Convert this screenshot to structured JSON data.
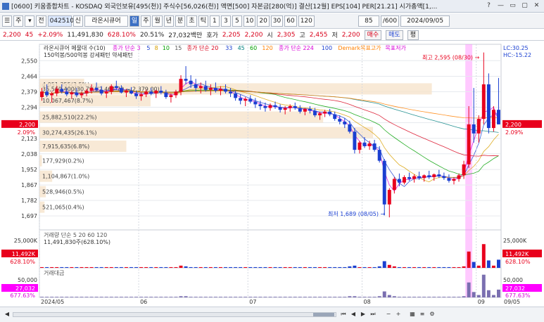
{
  "window": {
    "title": "[0600] 키움종합차트 - KOSDAQ 외국인보유[495(천)] 주식수[56,026(천)] 액면[500] 자본금[280(억)] 결산[12월] EPS[104] PER[21.21] 시가총액[1,...",
    "buttons": [
      "?",
      "—",
      "▭",
      "▢",
      "✕"
    ]
  },
  "toolbar": {
    "items": [
      "☰",
      "주",
      "▾",
      "전",
      "042510",
      "신",
      "라온시큐어",
      "일",
      "주",
      "월",
      "년",
      "분",
      "초",
      "틱",
      "1",
      "3",
      "5",
      "10",
      "20",
      "30",
      "60",
      "120"
    ],
    "count_value": "85",
    "count_total": "/600",
    "date": "2024/09/05"
  },
  "info": {
    "price": "2,200",
    "change": "45",
    "change_pct": "+2.09%",
    "volume": "11,491,830",
    "volume_pct": "628.10%",
    "turnover": "20.51%",
    "amount": "27,032백만",
    "ask_label": "호가",
    "ask": "2,205",
    "bid": "2,200",
    "open_label": "시",
    "open": "2,305",
    "high_label": "고",
    "high": "2,455",
    "low_label": "저",
    "low": "2,200",
    "buy": "매수",
    "sell": "매도",
    "avg": "평"
  },
  "chart_data": {
    "type": "candlestick",
    "price_axis": [
      "2,550",
      "2,464",
      "2,379",
      "2,294",
      "2,209",
      "2,123",
      "2,038",
      "1,952",
      "1,867",
      "1,782",
      "1,697"
    ],
    "ylim": [
      1620,
      2640
    ],
    "legend_line1": [
      {
        "text": "라온시큐어 메물대 수(10)",
        "color": "#333333"
      },
      {
        "text": "종가 단순 3",
        "color": "#d800d8"
      },
      {
        "text": "5",
        "color": "#1a3fd1"
      },
      {
        "text": "8",
        "color": "#d8a000"
      },
      {
        "text": "10",
        "color": "#00a000"
      },
      {
        "text": "15",
        "color": "#555555"
      },
      {
        "text": "종가 단순 20",
        "color": "#d8001a"
      },
      {
        "text": "33",
        "color": "#1a3fd1"
      },
      {
        "text": "45",
        "color": "#008080"
      },
      {
        "text": "60",
        "color": "#00a000"
      },
      {
        "text": "120",
        "color": "#ff8000"
      },
      {
        "text": "종가 단순 224",
        "color": "#d800d8"
      },
      {
        "text": "100",
        "color": "#1a3fd1"
      },
      {
        "text": "Demark목표고가",
        "color": "#ff8000"
      },
      {
        "text": "목표저가",
        "color": "#d800d8"
      }
    ],
    "legend_line2": "150억봉/500억봉 강세패턴 약세패턴",
    "lc_label": "LC:30.25",
    "hc_label": "HC:-15.22",
    "current_price_label": "2,200",
    "current_pct_label": "2.09%",
    "annotations": {
      "high": "최고 2,595 (08/30)",
      "low": "최저 1,689 (08/05)"
    },
    "volume_profile": [
      {
        "price": 2420,
        "label": "4,051,355(3.5%)"
      },
      {
        "price": 2330,
        "label": "10,067,467(8.7%)"
      },
      {
        "price": 2395,
        "label": "35,560,400(30.7%)(2,464.70 ~ 2,379.00)"
      },
      {
        "price": 2240,
        "label": "25,882,510(22.2%)"
      },
      {
        "price": 2155,
        "label": "30,274,435(26.1%)"
      },
      {
        "price": 2080,
        "label": "7,915,635(6.8%)"
      },
      {
        "price": 2000,
        "label": "177,929(0.2%)"
      },
      {
        "price": 1915,
        "label": "1,104,867(1.0%)"
      },
      {
        "price": 1830,
        "label": "528,946(0.5%)"
      },
      {
        "price": 1745,
        "label": "521,065(0.4%)"
      }
    ],
    "dates": [
      "2024/05",
      "06",
      "07",
      "08",
      "09",
      "09/05"
    ],
    "candles": [
      [
        2350,
        2400,
        2330,
        2380
      ],
      [
        2380,
        2420,
        2350,
        2360
      ],
      [
        2360,
        2380,
        2320,
        2370
      ],
      [
        2370,
        2410,
        2355,
        2395
      ],
      [
        2395,
        2420,
        2370,
        2380
      ],
      [
        2380,
        2400,
        2355,
        2365
      ],
      [
        2365,
        2385,
        2340,
        2375
      ],
      [
        2375,
        2400,
        2350,
        2360
      ],
      [
        2360,
        2380,
        2345,
        2370
      ],
      [
        2370,
        2395,
        2355,
        2385
      ],
      [
        2385,
        2420,
        2370,
        2400
      ],
      [
        2400,
        2430,
        2380,
        2390
      ],
      [
        2390,
        2410,
        2360,
        2370
      ],
      [
        2370,
        2390,
        2345,
        2380
      ],
      [
        2380,
        2420,
        2365,
        2410
      ],
      [
        2410,
        2440,
        2390,
        2400
      ],
      [
        2400,
        2415,
        2370,
        2375
      ],
      [
        2375,
        2395,
        2350,
        2385
      ],
      [
        2385,
        2405,
        2365,
        2370
      ],
      [
        2370,
        2385,
        2340,
        2355
      ],
      [
        2355,
        2375,
        2330,
        2365
      ],
      [
        2365,
        2390,
        2350,
        2380
      ],
      [
        2380,
        2400,
        2360,
        2370
      ],
      [
        2370,
        2390,
        2345,
        2385
      ],
      [
        2385,
        2410,
        2365,
        2375
      ],
      [
        2375,
        2390,
        2340,
        2350
      ],
      [
        2350,
        2370,
        2320,
        2360
      ],
      [
        2360,
        2390,
        2345,
        2380
      ],
      [
        2380,
        2470,
        2360,
        2450
      ],
      [
        2450,
        2520,
        2420,
        2440
      ],
      [
        2440,
        2470,
        2400,
        2420
      ],
      [
        2420,
        2450,
        2380,
        2400
      ],
      [
        2400,
        2430,
        2370,
        2410
      ],
      [
        2410,
        2440,
        2380,
        2390
      ],
      [
        2390,
        2420,
        2360,
        2400
      ],
      [
        2400,
        2430,
        2375,
        2385
      ],
      [
        2385,
        2410,
        2360,
        2395
      ],
      [
        2395,
        2420,
        2370,
        2380
      ],
      [
        2380,
        2400,
        2350,
        2370
      ],
      [
        2370,
        2385,
        2330,
        2345
      ],
      [
        2345,
        2365,
        2310,
        2330
      ],
      [
        2330,
        2350,
        2300,
        2340
      ],
      [
        2340,
        2360,
        2315,
        2325
      ],
      [
        2325,
        2345,
        2290,
        2310
      ],
      [
        2310,
        2330,
        2280,
        2300
      ],
      [
        2300,
        2320,
        2270,
        2290
      ],
      [
        2290,
        2315,
        2275,
        2305
      ],
      [
        2305,
        2325,
        2285,
        2295
      ],
      [
        2295,
        2310,
        2265,
        2280
      ],
      [
        2280,
        2300,
        2255,
        2290
      ],
      [
        2290,
        2310,
        2270,
        2300
      ],
      [
        2300,
        2320,
        2280,
        2290
      ],
      [
        2290,
        2305,
        2260,
        2270
      ],
      [
        2270,
        2290,
        2250,
        2285
      ],
      [
        2285,
        2300,
        2260,
        2275
      ],
      [
        2275,
        2290,
        2240,
        2250
      ],
      [
        2250,
        2270,
        2225,
        2260
      ],
      [
        2260,
        2280,
        2240,
        2270
      ],
      [
        2270,
        2285,
        2245,
        2255
      ],
      [
        2255,
        2270,
        2220,
        2230
      ],
      [
        2230,
        2250,
        2200,
        2215
      ],
      [
        2215,
        2235,
        2180,
        2200
      ],
      [
        2200,
        2220,
        2150,
        2160
      ],
      [
        2160,
        2180,
        2040,
        2060
      ],
      [
        2060,
        2110,
        2040,
        2100
      ],
      [
        2100,
        2130,
        2070,
        2080
      ],
      [
        2080,
        2110,
        2060,
        2095
      ],
      [
        2095,
        2115,
        2050,
        2060
      ],
      [
        2060,
        2080,
        1990,
        2000
      ],
      [
        2000,
        2010,
        1700,
        1760
      ],
      [
        1760,
        1850,
        1689,
        1840
      ],
      [
        1840,
        1910,
        1820,
        1900
      ],
      [
        1900,
        1930,
        1860,
        1880
      ],
      [
        1880,
        1920,
        1870,
        1910
      ],
      [
        1910,
        1935,
        1890,
        1900
      ],
      [
        1900,
        1925,
        1880,
        1915
      ],
      [
        1915,
        1940,
        1895,
        1905
      ],
      [
        1905,
        1925,
        1885,
        1920
      ],
      [
        1920,
        1945,
        1900,
        1910
      ],
      [
        1910,
        1930,
        1890,
        1925
      ],
      [
        1925,
        1950,
        1905,
        1915
      ],
      [
        1915,
        1935,
        1895,
        1905
      ],
      [
        1905,
        1925,
        1880,
        1890
      ],
      [
        1890,
        1910,
        1870,
        1900
      ],
      [
        1900,
        1930,
        1885,
        1920
      ],
      [
        1920,
        2000,
        1900,
        1980
      ],
      [
        1980,
        2300,
        1960,
        2200
      ],
      [
        2200,
        2400,
        2100,
        2150
      ],
      [
        2150,
        2250,
        2100,
        2230
      ],
      [
        2230,
        2595,
        2200,
        2420
      ],
      [
        2420,
        2480,
        2150,
        2180
      ],
      [
        2180,
        2300,
        2160,
        2280
      ],
      [
        2280,
        2455,
        2200,
        2200
      ]
    ],
    "volume_axis_label": "25,000K",
    "volume_current_label": "11,492K",
    "volume_current_pct": "628.10%",
    "volume_legend": "거래량 단순 5 20 60 120",
    "volume_value_text": "11,491,830주(628.10%)",
    "volume_bars": [
      1,
      1,
      1,
      1,
      1,
      1,
      1,
      1,
      1,
      1,
      1,
      1,
      1,
      1,
      1,
      1,
      1,
      1,
      1,
      1,
      1,
      1,
      1,
      1,
      1,
      1,
      1,
      1,
      3,
      2,
      1,
      1,
      1,
      1,
      1,
      1,
      1,
      1,
      1,
      1,
      1,
      1,
      1,
      1,
      1,
      1,
      1,
      1,
      1,
      1,
      1,
      1,
      1,
      1,
      1,
      1,
      1,
      1,
      1,
      1,
      1,
      1,
      2,
      3,
      1,
      1,
      1,
      1,
      2,
      9,
      4,
      2,
      1,
      1,
      1,
      1,
      1,
      1,
      1,
      1,
      1,
      1,
      1,
      1,
      1,
      2,
      22,
      8,
      3,
      32,
      10,
      3,
      11
    ],
    "amount_axis_label": "50,000",
    "amount_current_label": "27,032",
    "amount_current_pct": "677.63%",
    "amount_legend": "거래대금",
    "amount_bars": [
      1,
      1,
      1,
      1,
      1,
      1,
      1,
      1,
      1,
      1,
      1,
      1,
      1,
      1,
      1,
      1,
      1,
      1,
      1,
      1,
      1,
      1,
      1,
      1,
      1,
      1,
      1,
      1,
      2,
      2,
      1,
      1,
      1,
      1,
      1,
      1,
      1,
      1,
      1,
      1,
      1,
      1,
      1,
      1,
      1,
      1,
      1,
      1,
      1,
      1,
      1,
      1,
      1,
      1,
      1,
      1,
      1,
      1,
      1,
      1,
      1,
      1,
      2,
      2,
      1,
      1,
      1,
      1,
      2,
      10,
      4,
      2,
      1,
      1,
      1,
      1,
      1,
      1,
      1,
      1,
      1,
      1,
      1,
      1,
      1,
      2,
      25,
      9,
      4,
      38,
      12,
      4,
      13
    ],
    "colors": {
      "up": "#e8001c",
      "down": "#1a3fd1",
      "profile_fill": "#f6e3cc",
      "highlight": "#ff88ff",
      "price_box": "#e8001c",
      "volume_box": "#e8001c",
      "amount_box": "#ff00ff"
    }
  }
}
